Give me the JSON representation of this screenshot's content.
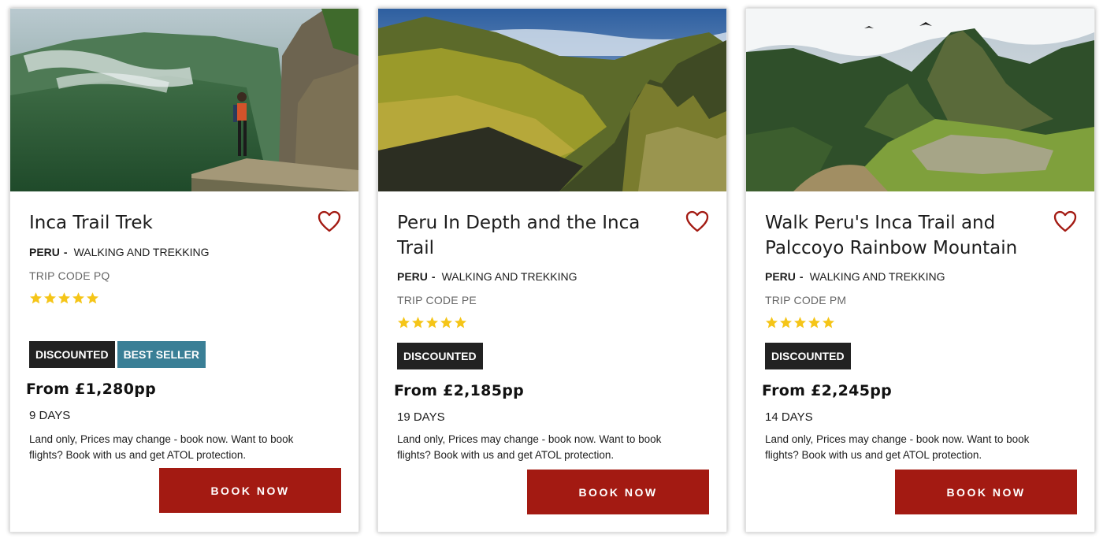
{
  "cards": [
    {
      "title": "Inca Trail Trek",
      "country": "PERU",
      "dash": "-",
      "activity": "WALKING AND TREKKING",
      "trip_code": "TRIP CODE PQ",
      "rating": 5,
      "badges": [
        "DISCOUNTED",
        "BEST SELLER"
      ],
      "price": "From £1,280pp",
      "duration": "9 DAYS",
      "note": "Land only, Prices may change - book now. Want to book flights? Book with us and get ATOL protection.",
      "cta": "BOOK NOW",
      "image": "hiker-on-inca-trail-cliff"
    },
    {
      "title": "Peru In Depth and the Inca Trail",
      "country": "PERU",
      "dash": "-",
      "activity": "WALKING AND TREKKING",
      "trip_code": "TRIP CODE PE",
      "rating": 5,
      "badges": [
        "DISCOUNTED"
      ],
      "price": "From £2,185pp",
      "duration": "19 DAYS",
      "note": "Land only, Prices may change - book now. Want to book flights? Book with us and get ATOL protection.",
      "cta": "BOOK NOW",
      "image": "andes-valley-machu-picchu-sunlight"
    },
    {
      "title": "Walk Peru's Inca Trail and Palccoyo Rainbow Mountain",
      "country": "PERU",
      "dash": "-",
      "activity": "WALKING AND TREKKING",
      "trip_code": "TRIP CODE PM",
      "rating": 5,
      "badges": [
        "DISCOUNTED"
      ],
      "price": "From £2,245pp",
      "duration": "14 DAYS",
      "note": "Land only, Prices may change - book now. Want to book flights? Book with us and get ATOL protection.",
      "cta": "BOOK NOW",
      "image": "machu-picchu-ruins-with-condors"
    }
  ],
  "colors": {
    "accent": "#a31a12",
    "star": "#f5c518",
    "badge_dark": "#222222",
    "badge_teal": "#3a7f96"
  },
  "icons": {
    "favorite": "heart-outline-icon",
    "rating": "star-icon"
  }
}
